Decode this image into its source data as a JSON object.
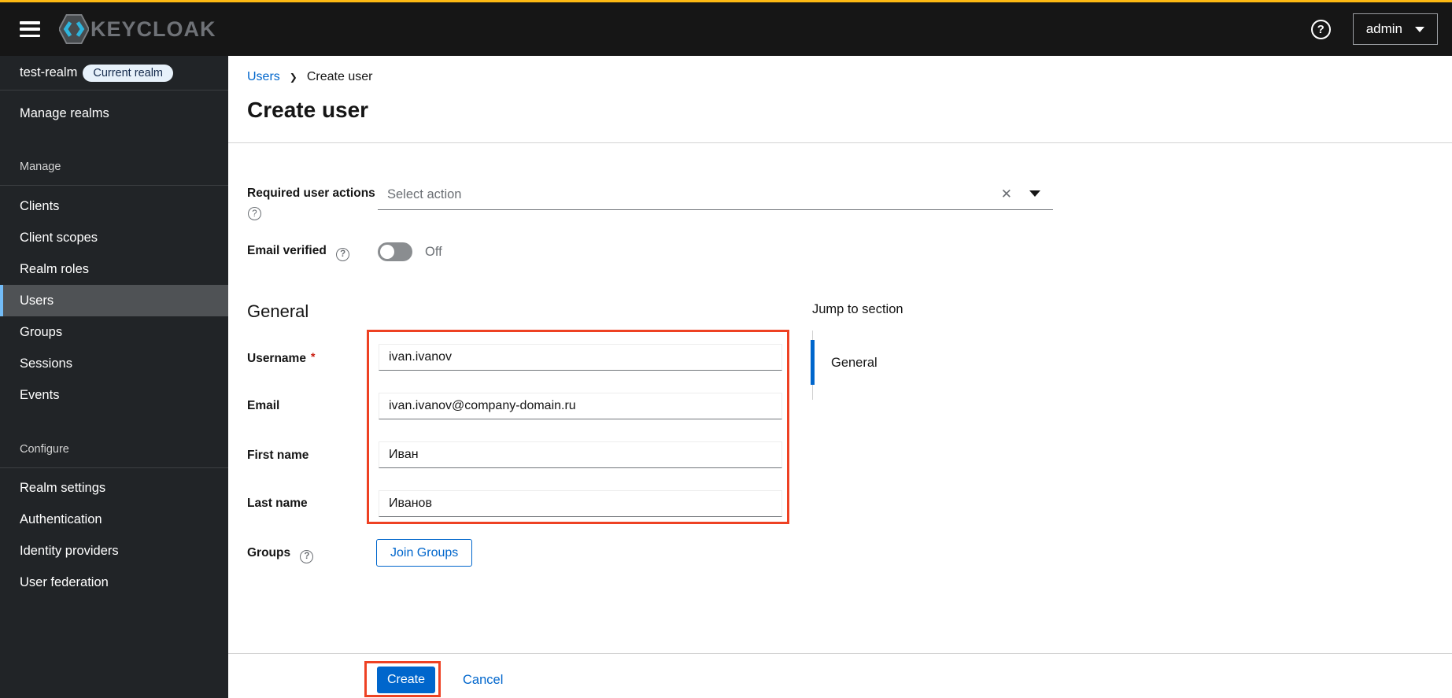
{
  "topbar": {
    "brand": "KEYCLOAK",
    "user_menu": "admin"
  },
  "icons": {
    "help": "?",
    "clear": "✕",
    "breadcrumb_separator": "❯",
    "required_asterisk": "*"
  },
  "sidebar": {
    "realm": {
      "name": "test-realm",
      "badge": "Current realm"
    },
    "top_item": "Manage realms",
    "sections": [
      {
        "label": "Manage",
        "items": [
          "Clients",
          "Client scopes",
          "Realm roles",
          "Users",
          "Groups",
          "Sessions",
          "Events"
        ],
        "active_item": "Users"
      },
      {
        "label": "Configure",
        "items": [
          "Realm settings",
          "Authentication",
          "Identity providers",
          "User federation"
        ]
      }
    ]
  },
  "breadcrumb": {
    "parent": "Users",
    "current": "Create user"
  },
  "page": {
    "title": "Create user"
  },
  "form": {
    "required_actions": {
      "label": "Required user actions",
      "placeholder": "Select action"
    },
    "email_verified": {
      "label": "Email verified",
      "state": "Off"
    },
    "general_heading": "General",
    "fields": [
      {
        "label": "Username",
        "required": "*",
        "value": "ivan.ivanov"
      },
      {
        "label": "Email",
        "value": "ivan.ivanov@company-domain.ru"
      },
      {
        "label": "First name",
        "value": "Иван"
      },
      {
        "label": "Last name",
        "value": "Иванов"
      }
    ],
    "groups": {
      "label": "Groups",
      "button": "Join Groups"
    }
  },
  "jump": {
    "title": "Jump to section",
    "links": [
      {
        "label": "General"
      }
    ]
  },
  "footer": {
    "create": "Create",
    "cancel": "Cancel"
  },
  "colors": {
    "accent_blue": "#0066cc",
    "masthead_bar": "#fdb913",
    "annotation_red": "#ee4123",
    "nav_active_indicator": "#73bcf7",
    "badge_bg": "#e7f1fa",
    "toggle_off": "#8a8d90"
  }
}
